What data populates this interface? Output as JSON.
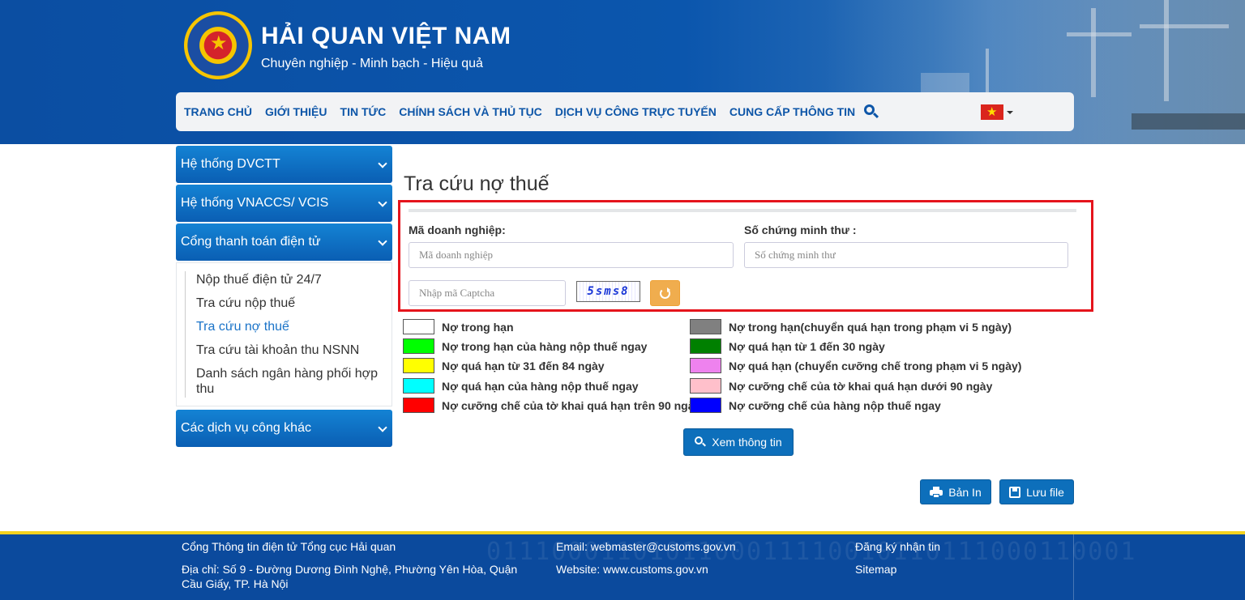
{
  "header": {
    "title": "HẢI QUAN VIỆT NAM",
    "slogan": "Chuyên nghiệp - Minh bạch - Hiệu quả"
  },
  "nav": {
    "items": [
      "TRANG CHỦ",
      "GIỚI THIỆU",
      "TIN TỨC",
      "CHÍNH SÁCH VÀ THỦ TỤC",
      "DỊCH VỤ CÔNG TRỰC TUYẾN",
      "CUNG CẤP THÔNG TIN"
    ]
  },
  "sidebar": {
    "sections": [
      "Hệ thống DVCTT",
      "Hệ thống VNACCS/ VCIS",
      "Cổng thanh toán điện tử",
      "Các dịch vụ công khác"
    ],
    "sub_items": [
      "Nộp thuế điện tử 24/7",
      "Tra cứu nộp thuế",
      "Tra cứu nợ thuế",
      "Tra cứu tài khoản thu NSNN",
      "Danh sách ngân hàng phối hợp thu"
    ]
  },
  "main": {
    "page_title": "Tra cứu nợ thuế",
    "form": {
      "business_code_label": "Mã doanh nghiệp:",
      "business_code_placeholder": "Mã doanh nghiệp",
      "id_label": "Số chứng minh thư :",
      "id_placeholder": "Số chứng minh thư",
      "captcha_placeholder": "Nhập mã Captcha",
      "captcha_text": "5sms8"
    },
    "legend": [
      {
        "label": "Nợ trong hạn",
        "color": "#ffffff"
      },
      {
        "label": "Nợ trong hạn(chuyển quá hạn trong phạm vi 5 ngày)",
        "color": "#808080"
      },
      {
        "label": "Nợ trong hạn của hàng nộp thuế ngay",
        "color": "#00ff00"
      },
      {
        "label": "Nợ quá hạn từ 1 đến 30 ngày",
        "color": "#008000"
      },
      {
        "label": "Nợ quá hạn từ 31 đến 84 ngày",
        "color": "#ffff00"
      },
      {
        "label": "Nợ quá hạn (chuyển cưỡng chế trong phạm vi 5 ngày)",
        "color": "#ee82ee"
      },
      {
        "label": "Nợ quá hạn của hàng nộp thuế ngay",
        "color": "#00ffff"
      },
      {
        "label": "Nợ cưỡng chế của tờ khai quá hạn dưới 90 ngày",
        "color": "#ffc0cb"
      },
      {
        "label": "Nợ cưỡng chế của tờ khai quá hạn trên 90 ngày",
        "color": "#ff0000"
      },
      {
        "label": "Nợ cưỡng chế của hàng nộp thuế ngay",
        "color": "#0000ff"
      }
    ],
    "view_button": "Xem thông tin",
    "print_button": "Bản In",
    "save_button": "Lưu file"
  },
  "footer": {
    "org": "Cổng Thông tin điện tử Tổng cục Hải quan",
    "address": "Địa chỉ: Số 9 - Đường Dương Đình Nghệ, Phường Yên Hòa, Quận Cầu Giấy, TP. Hà Nội",
    "email": "Email: webmaster@customs.gov.vn",
    "website": "Website: www.customs.gov.vn",
    "subscribe": "Đăng ký nhận tin",
    "sitemap": "Sitemap"
  },
  "colors": {
    "brand_blue": "#0b4ea2",
    "nav_text": "#0e56a8",
    "highlight_red": "#e5141c",
    "footer_yellow": "#f4d21f"
  }
}
